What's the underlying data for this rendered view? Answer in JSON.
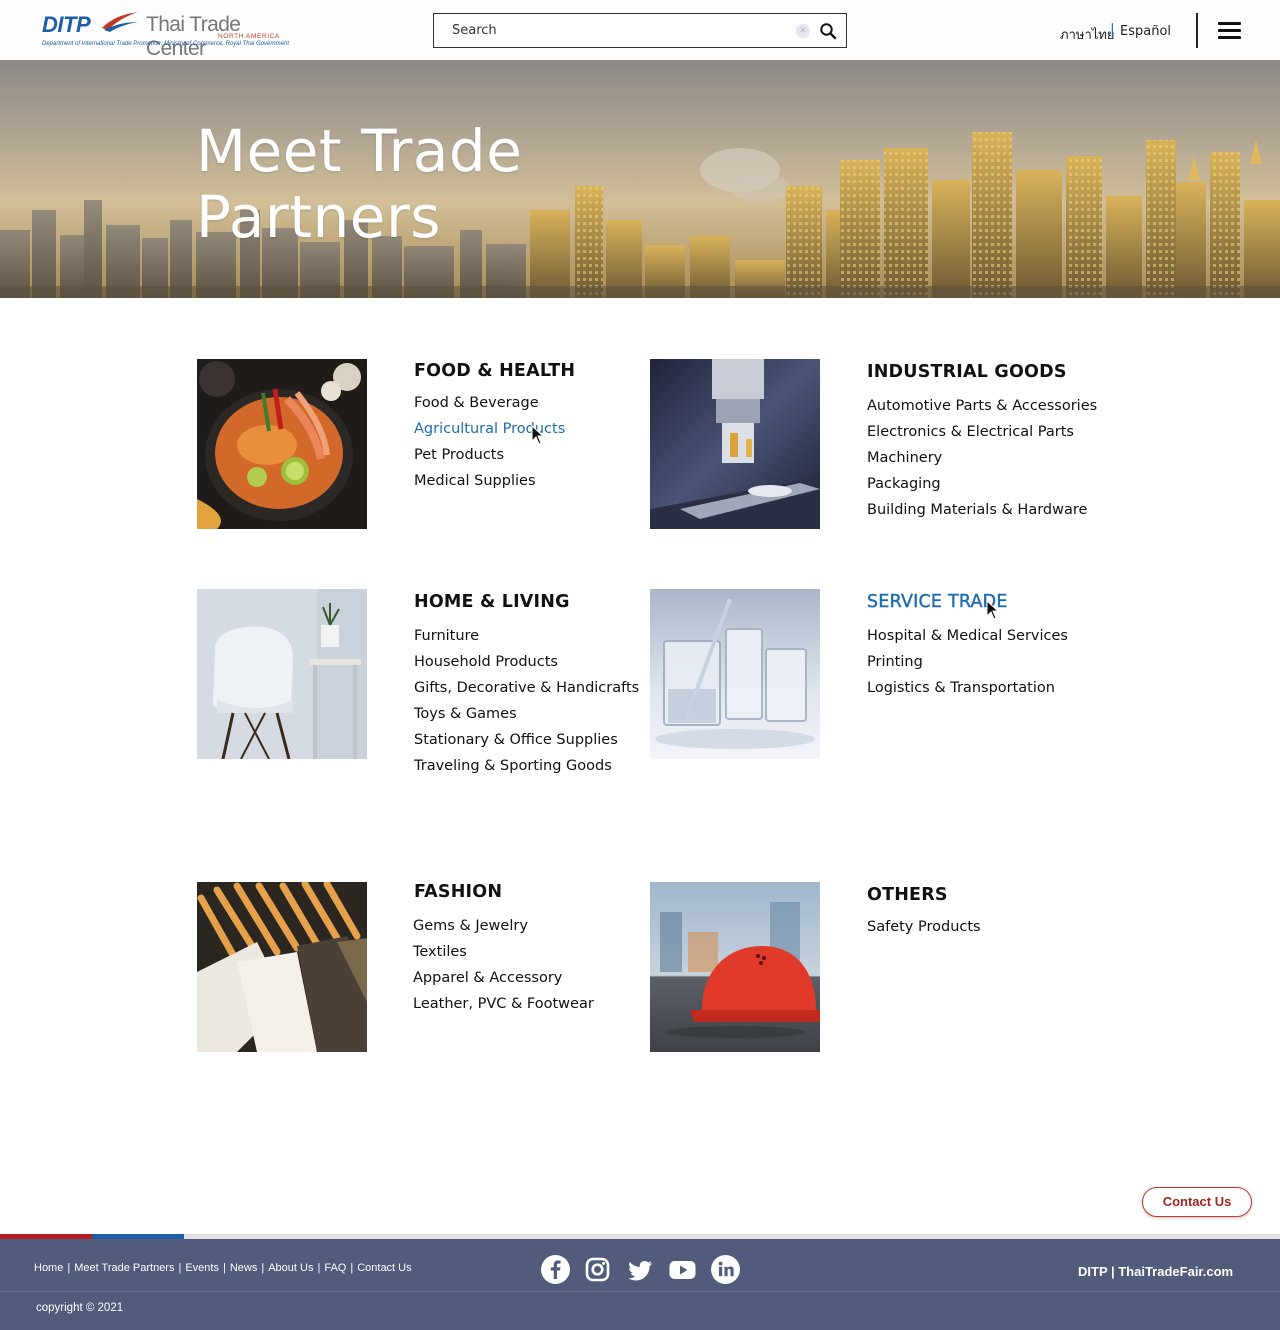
{
  "header": {
    "logo": {
      "ditp": "DITP",
      "center": "Thai Trade Center",
      "region": "NORTH AMERICA",
      "department": "Department of International Trade Promotion, Ministry of Commerce, Royal Thai Government"
    },
    "search": {
      "placeholder": "Search",
      "value": ""
    },
    "languages": [
      "ภาษาไทย",
      "Español"
    ],
    "language_separator": "|"
  },
  "hero": {
    "title_line1": "Meet Trade",
    "title_line2": "Partners"
  },
  "categories": [
    {
      "title": "FOOD & HEALTH",
      "image": "food-image",
      "items": [
        "Food & Beverage",
        "Agricultural Products",
        "Pet Products",
        "Medical Supplies"
      ],
      "hovered_item": "Agricultural Products"
    },
    {
      "title": "INDUSTRIAL GOODS",
      "image": "industrial-image",
      "items": [
        "Automotive Parts & Accessories",
        "Electronics & Electrical Parts",
        "Machinery",
        "Packaging",
        "Building Materials & Hardware"
      ]
    },
    {
      "title": "HOME & LIVING",
      "image": "home-image",
      "items": [
        "Furniture",
        "Household Products",
        "Gifts, Decorative & Handicrafts",
        "Toys & Games",
        "Stationary & Office Supplies",
        "Traveling & Sporting Goods"
      ]
    },
    {
      "title": "SERVICE TRADE",
      "image": "service-image",
      "items": [
        "Hospital & Medical Services",
        "Printing",
        "Logistics & Transportation"
      ],
      "hovered": true
    },
    {
      "title": "FASHION",
      "image": "fashion-image",
      "items": [
        "Gems & Jewelry",
        "Textiles",
        "Apparel & Accessory",
        "Leather, PVC & Footwear"
      ]
    },
    {
      "title": "OTHERS",
      "image": "others-image",
      "items": [
        "Safety Products"
      ]
    }
  ],
  "contact_button": "Contact Us",
  "footer": {
    "links": [
      "Home",
      "Meet Trade Partners",
      "Events",
      "News",
      "About Us",
      "FAQ",
      "Contact Us"
    ],
    "link_separator": "|",
    "social": [
      "facebook-icon",
      "instagram-icon",
      "twitter-icon",
      "youtube-icon",
      "linkedin-icon"
    ],
    "brand": "DITP | ThaiTradeFair.com",
    "copyright": "copyright © 2021"
  },
  "colors": {
    "link_active": "#1d6bb0",
    "footer_bg": "#515b7c",
    "stripe_red": "#b51f24",
    "stripe_blue": "#1d5ea8",
    "contact_button": "#a2241f"
  }
}
